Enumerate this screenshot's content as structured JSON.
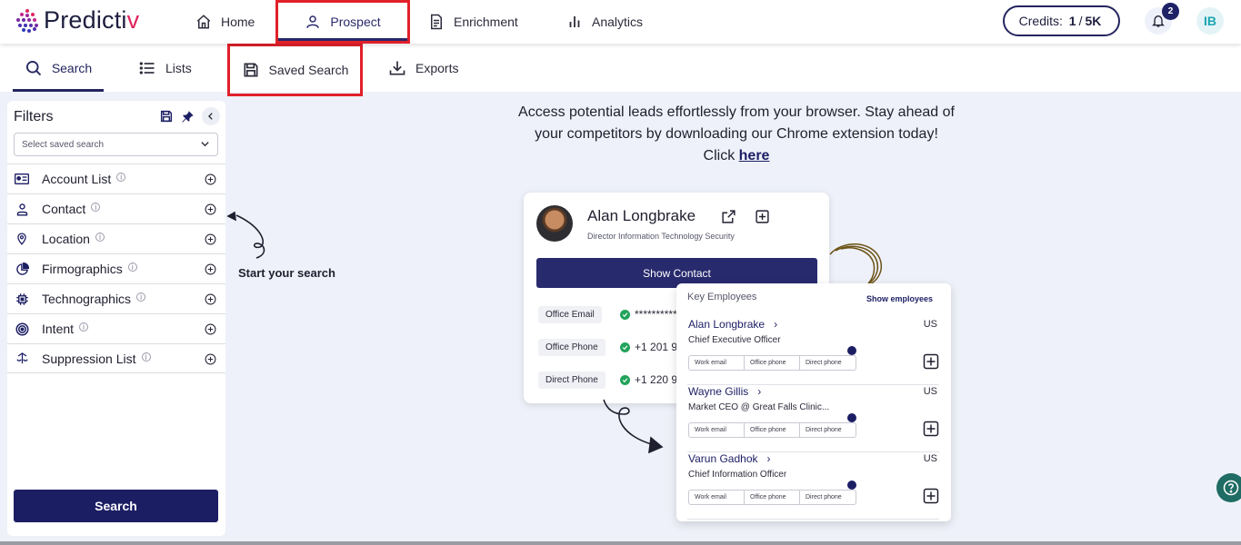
{
  "brand": {
    "name_main": "Predicti",
    "name_accent": "v",
    "accent_color": "#e0245e"
  },
  "nav": {
    "home": "Home",
    "prospect": "Prospect",
    "enrichment": "Enrichment",
    "analytics": "Analytics"
  },
  "credits": {
    "label": "Credits:",
    "used": "1",
    "separator": "/",
    "total": "5K"
  },
  "notifications": {
    "count": "2"
  },
  "user": {
    "initials": "IB"
  },
  "subtabs": {
    "search": "Search",
    "lists": "Lists",
    "saved_search": "Saved Search",
    "exports": "Exports"
  },
  "sidebar": {
    "title": "Filters",
    "saved_placeholder": "Select saved search",
    "filters": [
      "Account List",
      "Contact",
      "Location",
      "Firmographics",
      "Technographics",
      "Intent",
      "Suppression List"
    ],
    "search_button": "Search"
  },
  "hint": {
    "start": "Start your search"
  },
  "promo": {
    "line1": "Access potential leads effortlessly from your browser. Stay ahead of",
    "line2": "your competitors by downloading our Chrome extension today!",
    "click": "Click",
    "link": "here"
  },
  "contact_card": {
    "name": "Alan Longbrake",
    "role": "Director Information Technology Security",
    "show_contact": "Show Contact",
    "rows": [
      {
        "label": "Office Email",
        "value": "**********"
      },
      {
        "label": "Office Phone",
        "value": "+1 201 9"
      },
      {
        "label": "Direct Phone",
        "value": "+1 220 9"
      }
    ]
  },
  "employees": {
    "title": "Key Employees",
    "show": "Show employees",
    "chips": [
      "Work email",
      "Office phone",
      "Direct phone"
    ],
    "items": [
      {
        "name": "Alan Longbrake",
        "country": "US",
        "title": "Chief Executive Officer"
      },
      {
        "name": "Wayne Gillis",
        "country": "US",
        "title": "Market CEO @ Great Falls Clinic..."
      },
      {
        "name": "Varun Gadhok",
        "country": "US",
        "title": "Chief Information Officer"
      }
    ]
  },
  "colors": {
    "primary": "#1c1e64",
    "highlight": "#e0202a",
    "success": "#22a35b"
  }
}
